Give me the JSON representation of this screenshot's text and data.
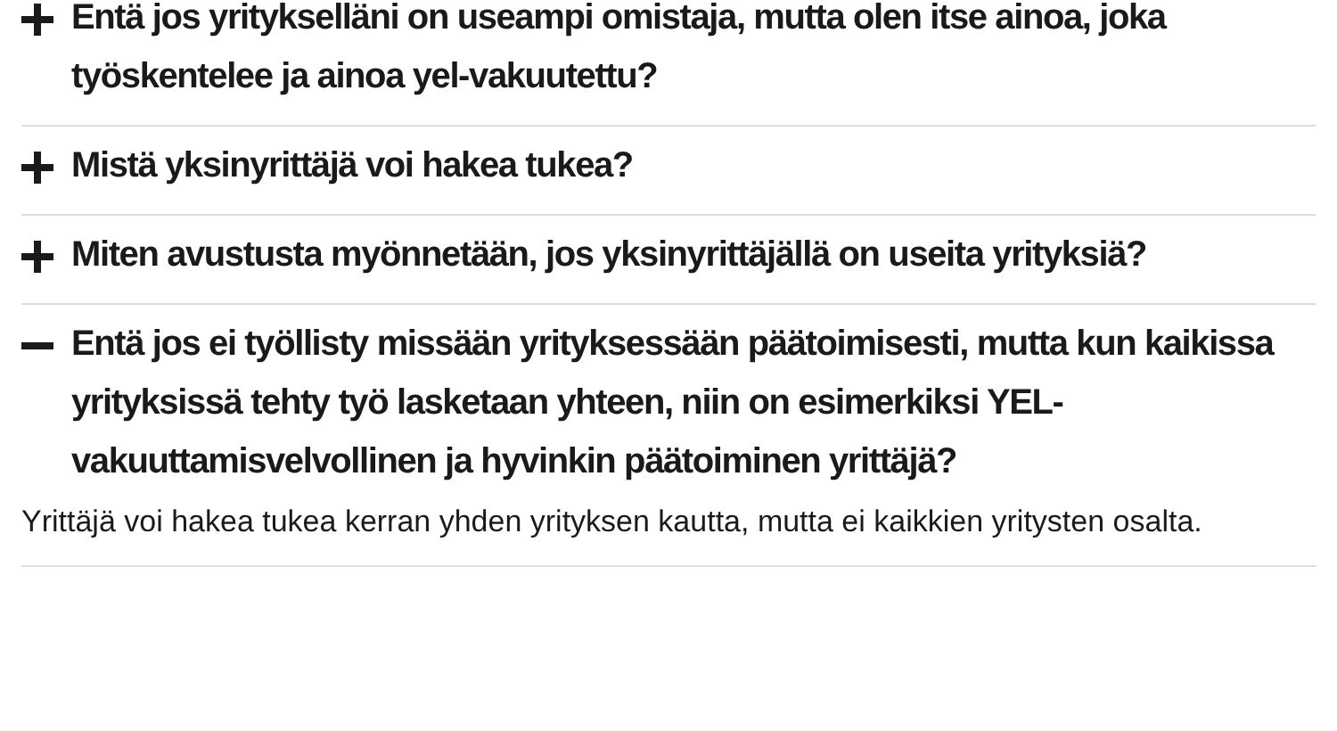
{
  "faq": [
    {
      "question": "Entä jos yritykselläni on useampi omistaja, mutta olen itse ainoa, joka työskentelee ja ainoa yel-vakuutettu?",
      "expanded": false
    },
    {
      "question": "Mistä yksinyrittäjä voi hakea tukea?",
      "expanded": false
    },
    {
      "question": "Miten avustusta myönnetään, jos yksinyrittäjällä on useita yrityksiä?",
      "expanded": false
    },
    {
      "question": "Entä jos ei työllisty missään yrityksessään päätoimisesti, mutta kun kaikissa yrityksissä tehty työ lasketaan yhteen, niin on esimerkiksi YEL-vakuuttamisvelvollinen ja hyvinkin päätoiminen yrittäjä?",
      "expanded": true,
      "answer": "Yrittäjä voi hakea tukea kerran yhden yrityksen kautta, mutta ei kaikkien yritysten osalta."
    }
  ]
}
